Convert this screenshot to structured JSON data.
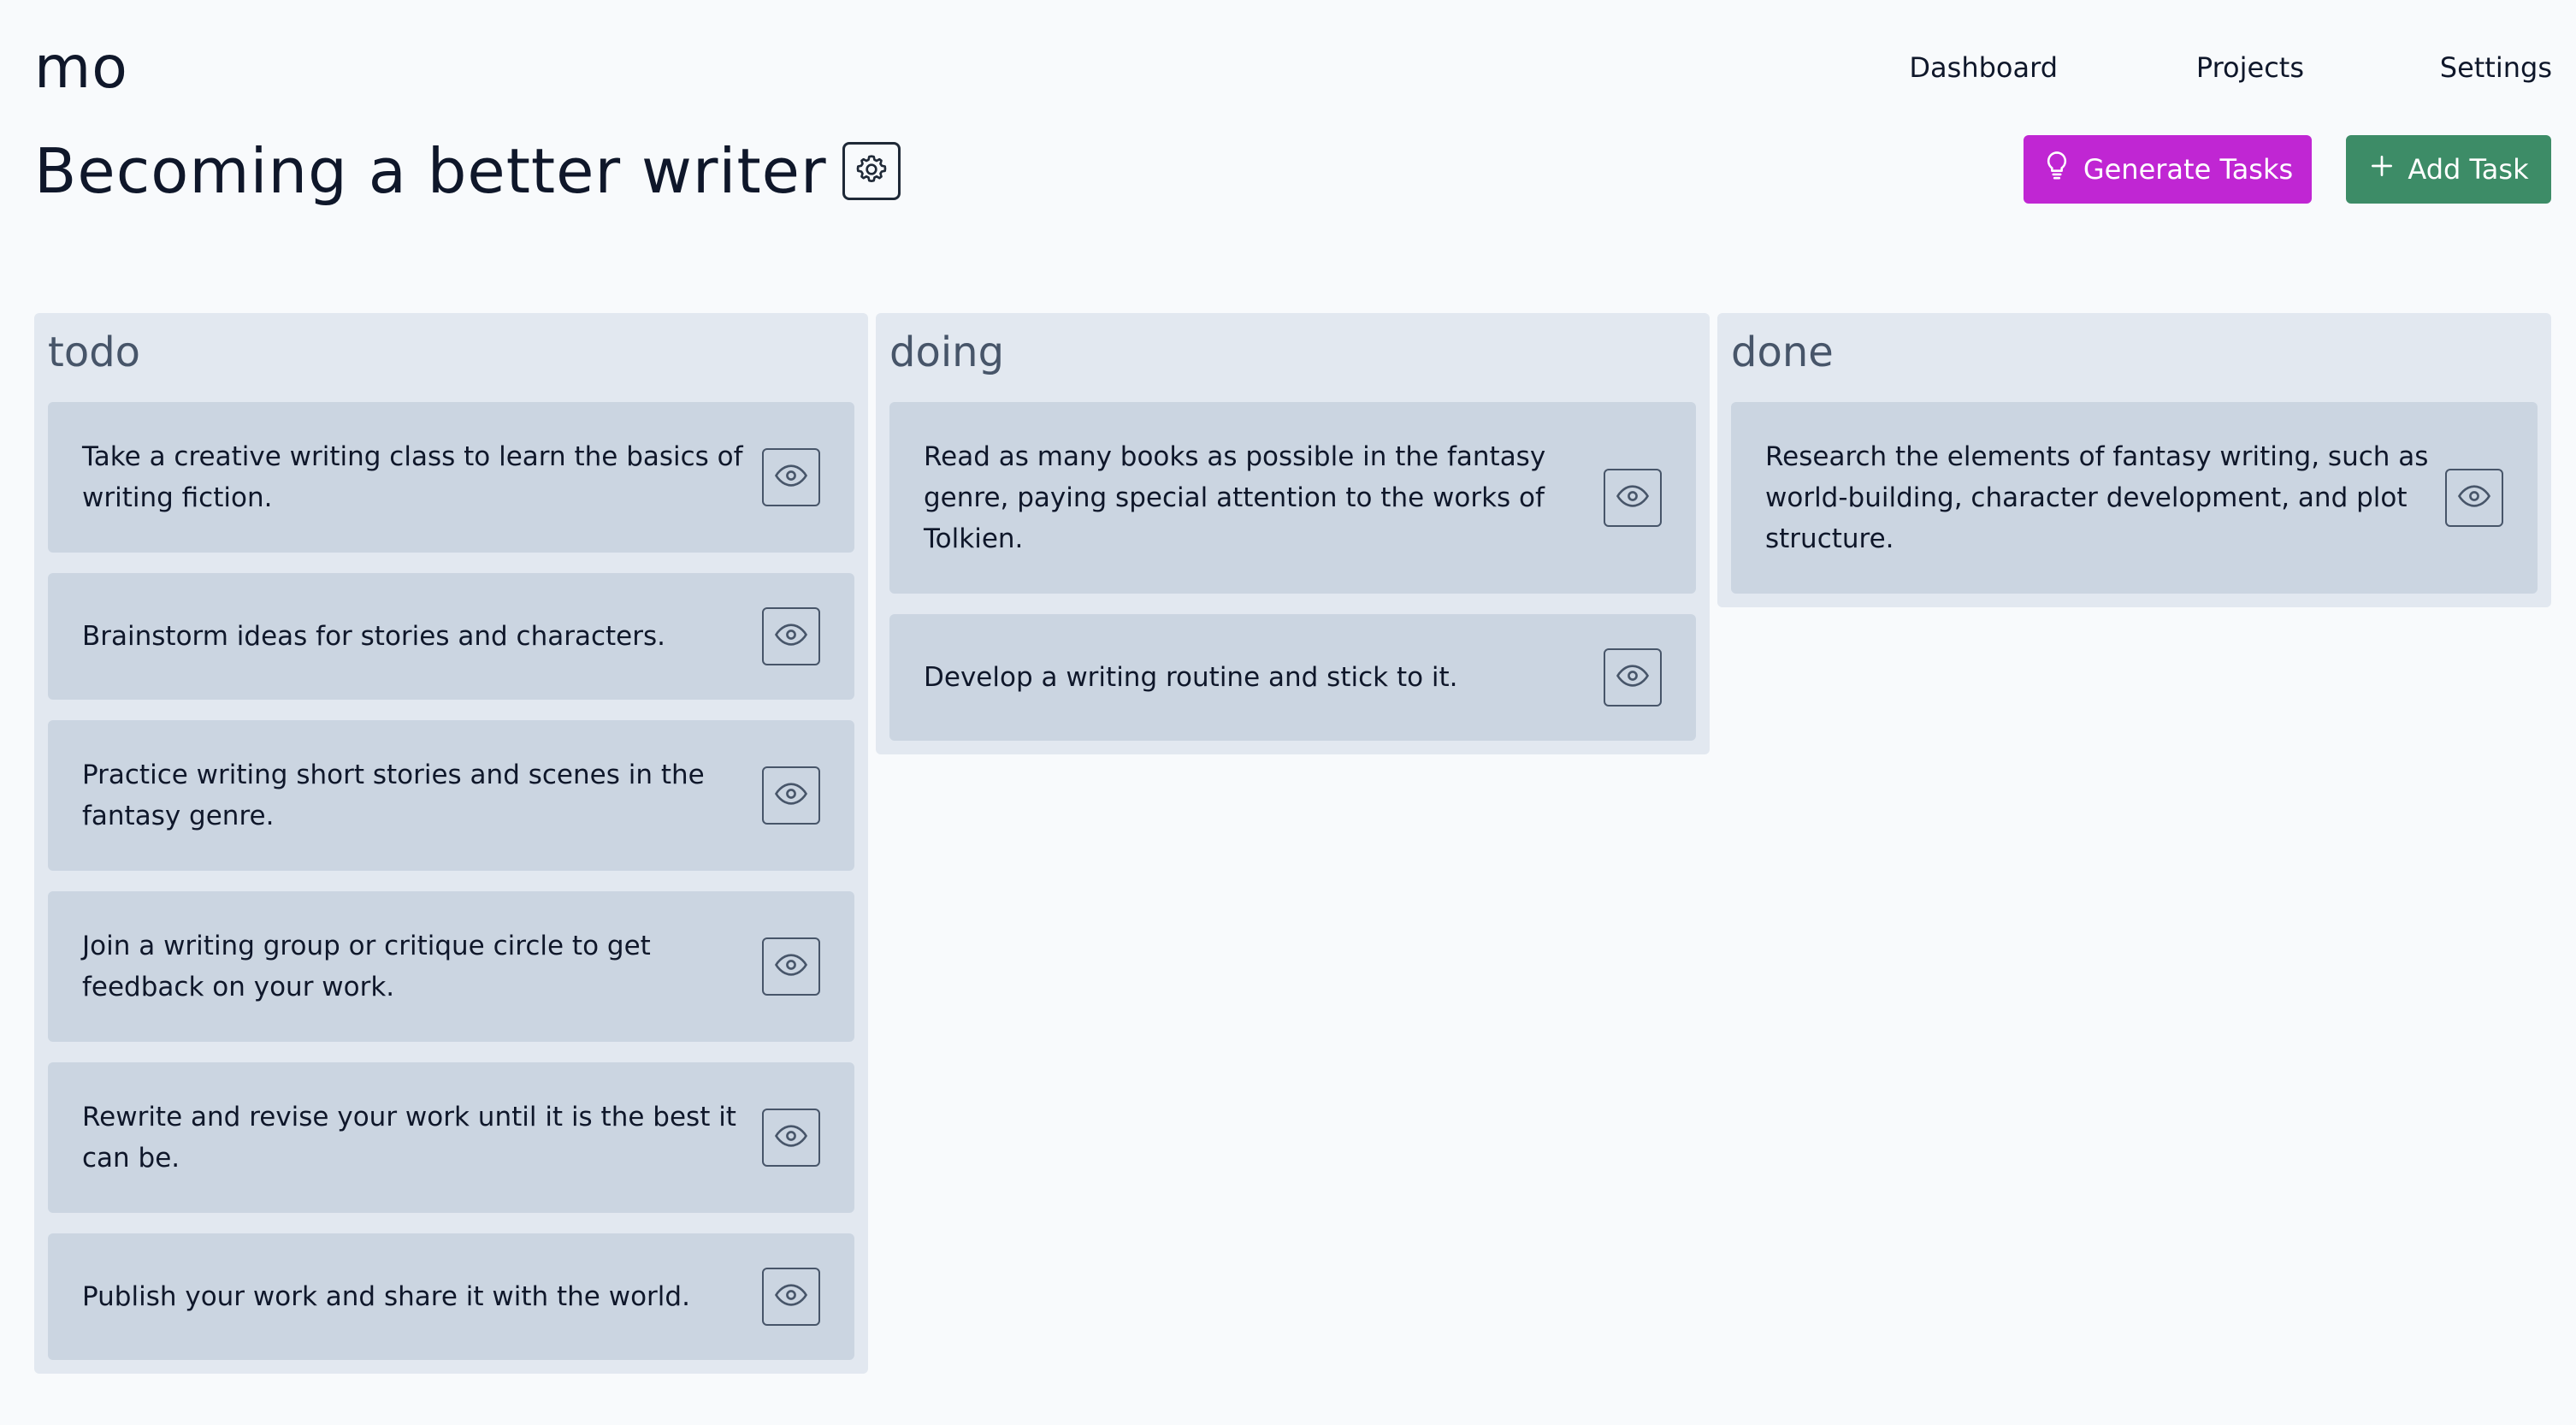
{
  "app": {
    "logo": "mo"
  },
  "nav": {
    "dashboard": "Dashboard",
    "projects": "Projects",
    "settings": "Settings"
  },
  "project": {
    "title": "Becoming a better writer"
  },
  "actions": {
    "generate_label": "Generate Tasks",
    "add_label": "Add Task",
    "generate_color": "#c026d3",
    "add_color": "#3d8c67"
  },
  "columns": {
    "todo": {
      "title": "todo",
      "cards": [
        "Take a creative writing class to learn the basics of writing fiction.",
        "Brainstorm ideas for stories and characters.",
        "Practice writing short stories and scenes in the fantasy genre.",
        "Join a writing group or critique circle to get feedback on your work.",
        "Rewrite and revise your work until it is the best it can be.",
        "Publish your work and share it with the world."
      ]
    },
    "doing": {
      "title": "doing",
      "cards": [
        "Read as many books as possible in the fantasy genre, paying special attention to the works of Tolkien.",
        "Develop a writing routine and stick to it."
      ]
    },
    "done": {
      "title": "done",
      "cards": [
        "Research the elements of fantasy writing, such as world-building, character development, and plot structure."
      ]
    }
  },
  "icons": {
    "settings": "gear-icon",
    "generate": "lightbulb-icon",
    "add": "plus-icon",
    "view": "eye-icon"
  }
}
